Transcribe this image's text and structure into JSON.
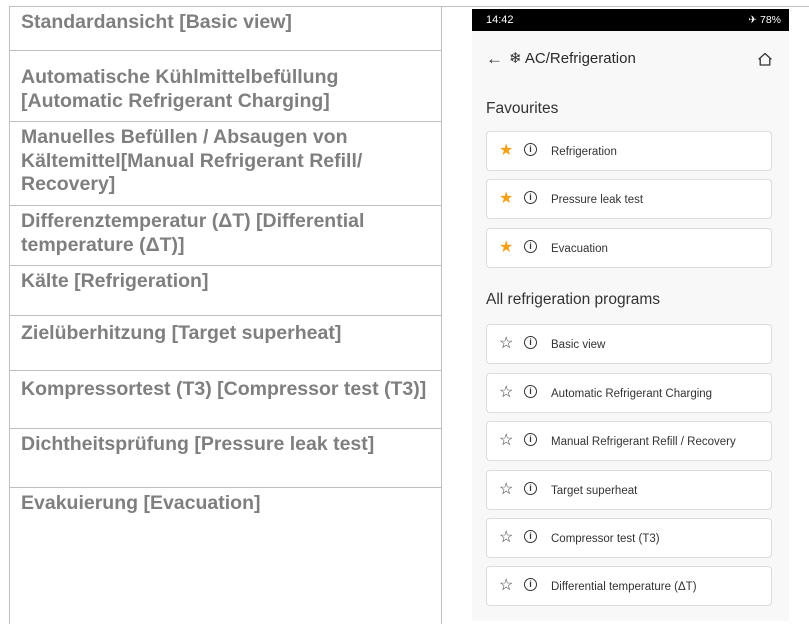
{
  "left_table": {
    "rows": [
      "Standardansicht [Basic view]",
      "Automatische Kühlmittelbefüllung [Automatic Refrigerant Charging]",
      "Manuelles Befüllen / Absaugen von Kältemittel[Manual Refrigerant Refill/ Recovery]",
      "Differenztemperatur (ΔT) [Differential temperature (ΔT)]",
      "Kälte [Refrigeration]",
      "Zielüberhitzung [Target superheat]",
      "Kompressortest (T3) [Compressor test (T3)]",
      "Dichtheitsprüfung [Pressure leak test]",
      "Evakuierung [Evacuation]"
    ]
  },
  "phone": {
    "status_time": "14:42",
    "status_right": "✈ 78%",
    "title": "❄ AC/Refrigeration",
    "favourites_title": "Favourites",
    "favourites": [
      "Refrigeration",
      "Pressure leak test",
      "Evacuation"
    ],
    "all_title": "All refrigeration programs",
    "programs": [
      "Basic view",
      "Automatic Refrigerant Charging",
      "Manual Refrigerant Refill / Recovery",
      "Target superheat",
      "Compressor test (T3)",
      "Differential temperature (ΔT)"
    ]
  },
  "colors": {
    "favourite_star": "#f5a01a",
    "table_text": "#7f7f7f"
  },
  "icons": {
    "back": "arrow-left-icon",
    "home": "home-icon",
    "favourite": "star-filled-icon",
    "not_favourite": "star-outline-icon",
    "info": "info-icon"
  }
}
